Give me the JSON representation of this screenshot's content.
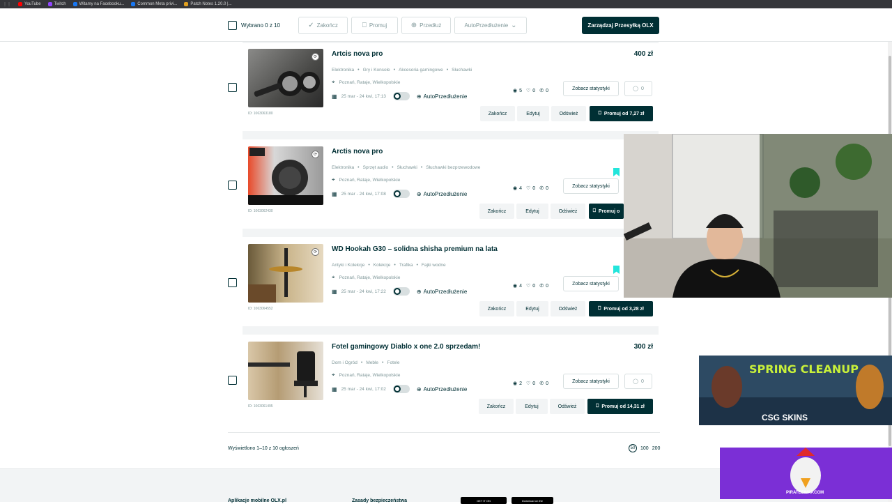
{
  "bookmarks": [
    {
      "label": "YouTube",
      "color": "#ff0000"
    },
    {
      "label": "Twitch",
      "color": "#9146ff"
    },
    {
      "label": "Witamy na Facebooku...",
      "color": "#1877f2"
    },
    {
      "label": "Common Meta privi...",
      "color": "#1877f2"
    },
    {
      "label": "Patch Notes 1.20.0 |...",
      "color": "#e0a020"
    }
  ],
  "toolbar": {
    "selected": "Wybrano 0 z 10",
    "end_label": "Zakończ",
    "promote_label": "Promuj",
    "extend_label": "Przedłuż",
    "auto_label": "AutoPrzedłużenie",
    "manage_label": "Zarządzaj Przesyłką OLX"
  },
  "listings": [
    {
      "title": "Artcis nova pro",
      "price": "400 zł",
      "categories": [
        "Elektronika",
        "Gry i Konsole",
        "Akcesoria gamingowe",
        "Słuchawki"
      ],
      "location": "Poznań, Rataje, Wielkopolskie",
      "dates": "25 mar - 24 kwi, 17:13",
      "auto": "AutoPrzedłużenie",
      "views": "5",
      "likes": "0",
      "calls": "0",
      "stats_label": "Zobacz statystyki",
      "messages": "0",
      "ad_id": "ID: 1063063180",
      "actions": [
        "Zakończ",
        "Edytuj",
        "Odśwież"
      ],
      "promote": "Promuj od 7,27 zł"
    },
    {
      "title": "Arctis nova pro",
      "price": "",
      "categories": [
        "Elektronika",
        "Sprzęt audio",
        "Słuchawki",
        "Słuchawki bezprzewodowe"
      ],
      "location": "Poznań, Rataje, Wielkopolskie",
      "dates": "25 mar - 24 kwi, 17:08",
      "auto": "AutoPrzedłużenie",
      "views": "4",
      "likes": "0",
      "calls": "0",
      "stats_label": "Zobacz statystyki",
      "messages": "",
      "ad_id": "ID: 1063062430",
      "actions": [
        "Zakończ",
        "Edytuj",
        "Odśwież"
      ],
      "promote": "Promuj o"
    },
    {
      "title": "WD Hookah G30 – solidna shisha premium na lata",
      "price": "",
      "categories": [
        "Antyki i Kolekcje",
        "Kolekcje",
        "Trafika",
        "Fajki wodne"
      ],
      "location": "Poznań, Rataje, Wielkopolskie",
      "dates": "25 mar - 24 kwi, 17:22",
      "auto": "AutoPrzedłużenie",
      "views": "4",
      "likes": "0",
      "calls": "0",
      "stats_label": "Zobacz statystyki",
      "messages": "",
      "ad_id": "ID: 1063064552",
      "actions": [
        "Zakończ",
        "Edytuj",
        "Odśwież"
      ],
      "promote": "Promuj od 3,28 zł"
    },
    {
      "title": "Fotel gamingowy Diablo x one 2.0 sprzedam!",
      "price": "300 zł",
      "categories": [
        "Dom i Ogród",
        "Meble",
        "Fotele"
      ],
      "location": "Poznań, Rataje, Wielkopolskie",
      "dates": "25 mar - 24 kwi, 17:02",
      "auto": "AutoPrzedłużenie",
      "views": "2",
      "likes": "0",
      "calls": "0",
      "stats_label": "Zobacz statystyki",
      "messages": "0",
      "ad_id": "ID: 1063061495",
      "actions": [
        "Zakończ",
        "Edytuj",
        "Odśwież"
      ],
      "promote": "Promuj od 14,31 zł"
    }
  ],
  "footer": {
    "showing": "Wyświetlono 1–10 z 10 ogłoszeń",
    "page_sizes": [
      "50",
      "100",
      "200"
    ],
    "col1": "Aplikacje mobilne OLX.pl",
    "col2": "Zasady bezpieczeństwa",
    "store1": "GET IT ON",
    "store2": "Download on the"
  },
  "overlays": {
    "ad1_title": "SPRING CLEANUP",
    "ad1_brand": "CSG SKINS",
    "ad2_brand": "PIRATESWAP.COM"
  },
  "colors": {
    "brand": "#002f34",
    "accent": "#23e5db"
  }
}
